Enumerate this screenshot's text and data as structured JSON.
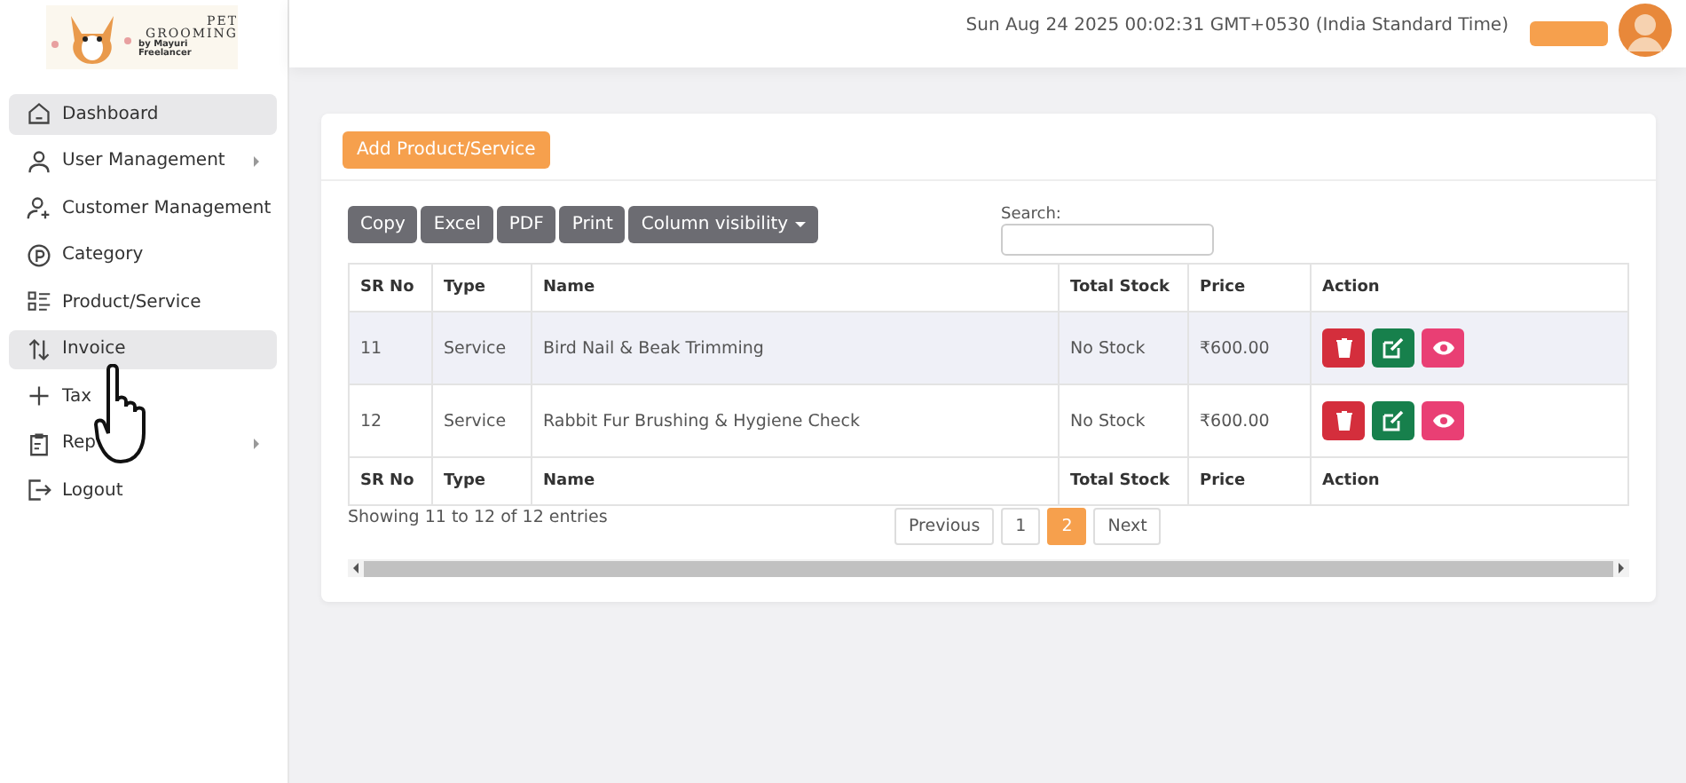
{
  "brand": {
    "line_1": "PET",
    "line_2": "GROOMING",
    "line_3": "by Mayuri Freelancer"
  },
  "header": {
    "datetime": "Sun Aug 24 2025 00:02:31 GMT+0530 (India Standard Time)"
  },
  "sidebar": {
    "items": [
      {
        "label": "Dashboard",
        "selected": true,
        "has_submenu": false
      },
      {
        "label": "User Management",
        "selected": false,
        "has_submenu": true
      },
      {
        "label": "Customer Management",
        "selected": false,
        "has_submenu": false
      },
      {
        "label": "Category",
        "selected": false,
        "has_submenu": false
      },
      {
        "label": "Product/Service",
        "selected": false,
        "has_submenu": false
      },
      {
        "label": "Invoice",
        "selected": true,
        "has_submenu": false
      },
      {
        "label": "Tax",
        "selected": false,
        "has_submenu": false
      },
      {
        "label": "Rep",
        "selected": false,
        "has_submenu": true
      },
      {
        "label": "Logout",
        "selected": false,
        "has_submenu": false
      }
    ]
  },
  "card": {
    "add_button": "Add Product/Service",
    "export_buttons": [
      {
        "label": "Copy",
        "dropdown": false
      },
      {
        "label": "Excel",
        "dropdown": false
      },
      {
        "label": "PDF",
        "dropdown": false
      },
      {
        "label": "Print",
        "dropdown": false
      },
      {
        "label": "Column visibility",
        "dropdown": true
      }
    ],
    "search": {
      "label": "Search:"
    },
    "table": {
      "columns": [
        "SR No",
        "Type",
        "Name",
        "Total Stock",
        "Price",
        "Action"
      ],
      "rows": [
        {
          "sr_no": "11",
          "type": "Service",
          "name": "Bird Nail & Beak Trimming",
          "total_stock": "No Stock",
          "price": "₹600.00",
          "hovered": true
        },
        {
          "sr_no": "12",
          "type": "Service",
          "name": "Rabbit Fur Brushing & Hygiene Check",
          "total_stock": "No Stock",
          "price": "₹600.00",
          "hovered": false
        }
      ],
      "footer": [
        "SR No",
        "Type",
        "Name",
        "Total Stock",
        "Price",
        "Action"
      ]
    },
    "info": "Showing 11 to 12 of 12 entries",
    "pagination": [
      {
        "label": "Previous",
        "selected": false
      },
      {
        "label": "1",
        "selected": false
      },
      {
        "label": "2",
        "selected": true
      },
      {
        "label": "Next",
        "selected": false
      }
    ]
  }
}
